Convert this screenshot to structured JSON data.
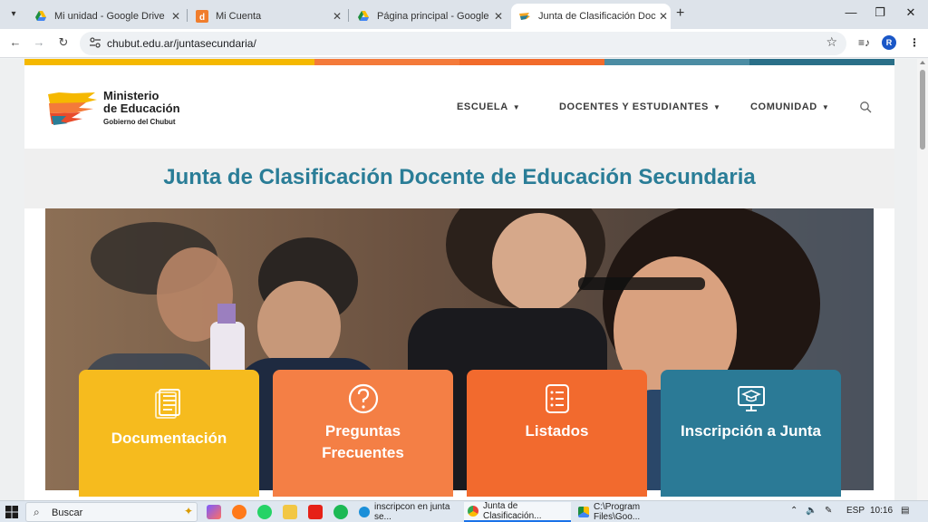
{
  "browser": {
    "tabs": [
      {
        "title": "Mi unidad - Google Drive",
        "favicon": "google-drive-icon",
        "active": false
      },
      {
        "title": "Mi Cuenta",
        "favicon": "mi-cuenta-d-icon",
        "active": false
      },
      {
        "title": "Página principal - Google Drive",
        "favicon": "google-drive-icon",
        "active": false
      },
      {
        "title": "Junta de Clasificación Docente",
        "favicon": "ministerio-icon",
        "active": true
      }
    ],
    "new_tab_label": "+",
    "url": "chubut.edu.ar/juntasecundaria/",
    "profile_initial": "R"
  },
  "site": {
    "colors": [
      "#f5b800",
      "#f5b800",
      "#f47a3a",
      "#f26b2b",
      "#4b8ca3",
      "#2a6f88"
    ],
    "logo": {
      "line1": "Ministerio",
      "line2": "de Educación",
      "line3": "Gobierno del Chubut"
    },
    "menu": [
      {
        "label": "ESCUELA"
      },
      {
        "label": "DOCENTES Y ESTUDIANTES"
      },
      {
        "label": "COMUNIDAD"
      }
    ],
    "page_title": "Junta de Clasificación Docente de Educación Secundaria",
    "cards": [
      {
        "label": "Documentación",
        "icon": "document-icon",
        "color": "#f6bb1e"
      },
      {
        "label": "Preguntas Frecuentes",
        "icon": "question-circle-icon",
        "color": "#f47f45"
      },
      {
        "label": "Listados",
        "icon": "checklist-icon",
        "color": "#f26a2e"
      },
      {
        "label": "Inscripción a Junta",
        "icon": "computer-graduation-icon",
        "color": "#2b7a96"
      }
    ]
  },
  "taskbar": {
    "search_placeholder": "Buscar",
    "tasks": [
      {
        "title": "inscripcon en junta se...",
        "icon": "edge-icon"
      },
      {
        "title": "Junta de Clasificación...",
        "icon": "chrome-icon",
        "active": true
      },
      {
        "title": "C:\\Program Files\\Goo...",
        "icon": "drive-icon"
      }
    ],
    "language": "ESP",
    "time": "10:16"
  }
}
